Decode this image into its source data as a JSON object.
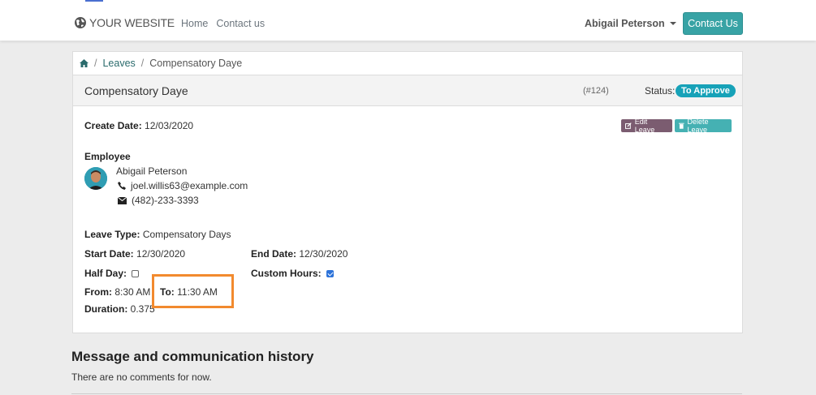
{
  "header": {
    "logo_text": "YOUR WEBSITE",
    "nav": [
      "Home",
      "Contact us"
    ],
    "user_name": "Abigail Peterson",
    "contact_button": "Contact Us"
  },
  "breadcrumb": {
    "home_icon": "home-icon",
    "items": [
      "Leaves",
      "Compensatory Daye"
    ]
  },
  "leave": {
    "title": "Compensatory Daye",
    "ref": "(#124)",
    "status_label": "Status:",
    "status_value": "To Approve",
    "create_date_label": "Create Date:",
    "create_date": "12/03/2020",
    "edit_button": "Edit Leave",
    "delete_button": "Delete Leave",
    "employee_label": "Employee",
    "employee_name": "Abigail Peterson",
    "employee_email": "joel.willis63@example.com",
    "employee_phone": "(482)-233-3393",
    "leave_type_label": "Leave Type:",
    "leave_type": "Compensatory Days",
    "start_date_label": "Start Date:",
    "start_date": "12/30/2020",
    "end_date_label": "End Date:",
    "end_date": "12/30/2020",
    "half_day_label": "Half Day:",
    "half_day": false,
    "custom_hours_label": "Custom Hours:",
    "custom_hours": true,
    "from_label": "From:",
    "from": "8:30 AM",
    "to_label": "To:",
    "to": "11:30 AM",
    "duration_label": "Duration:",
    "duration": "0.375"
  },
  "history": {
    "title": "Message and communication history",
    "empty_text": "There are no comments for now."
  },
  "colors": {
    "accent": "#38a3a5",
    "status_badge": "#17a2b8",
    "highlight": "#f28a2e"
  }
}
